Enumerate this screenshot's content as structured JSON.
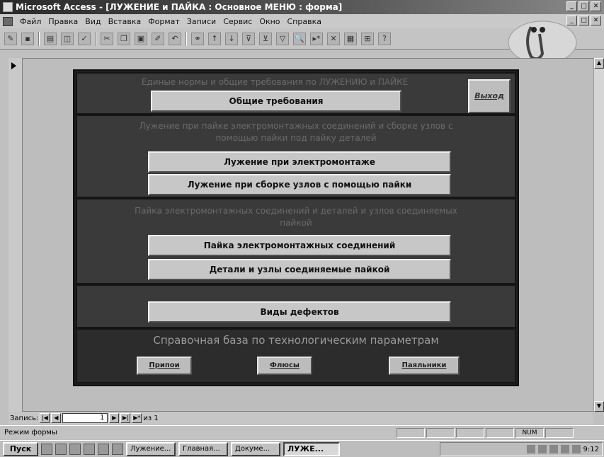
{
  "window": {
    "title": "Microsoft Access - [ЛУЖЕНИЕ и ПАЙКА : Основное МЕНЮ : форма]",
    "min": "_",
    "max": "□",
    "close": "✕"
  },
  "menu": [
    "Файл",
    "Правка",
    "Вид",
    "Вставка",
    "Формат",
    "Записи",
    "Сервис",
    "Окно",
    "Справка"
  ],
  "form": {
    "section1_text": "Единые нормы и общие требования по ЛУЖЕНИЮ и ПАЙКЕ",
    "general_requirements": "Общие требования",
    "exit": "Выход",
    "section2_text": "Лужение при пайке электромонтажных соединений и сборке узлов с помощью пайки под пайку деталей",
    "tinning_electro": "Лужение при электромонтаже",
    "tinning_assembly": "Лужение при сборке узлов с помощью пайки",
    "section3_text": "Пайка электромонтажных соединений и деталей и узлов соединяемых пайкой",
    "soldering_electro": "Пайка электромонтажных соединений",
    "soldered_parts": "Детали и узлы соединяемые пайкой",
    "defects": "Виды дефектов",
    "reference_title": "Справочная база по технологическим параметрам",
    "solders": "Припои",
    "fluxes": "Флюсы",
    "solderability": "Паяльники"
  },
  "recnav": {
    "label": "Запись:",
    "current": "1",
    "of": "из 1"
  },
  "status": {
    "mode": "Режим формы",
    "num": "NUM"
  },
  "taskbar": {
    "start": "Пуск",
    "tasks": [
      "Лужение...",
      "Главная...",
      "Докумe...",
      "ЛУЖЕ..."
    ],
    "clock": "9:12"
  }
}
